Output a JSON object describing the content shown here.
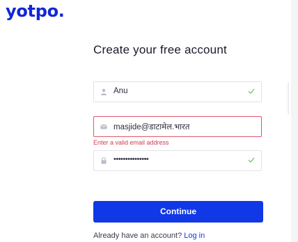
{
  "logo": {
    "text": "yotpo."
  },
  "form": {
    "title": "Create your free account",
    "name_field": {
      "value": "Anu",
      "valid": true
    },
    "email_field": {
      "value": "masjide@डाटामेल.भारत",
      "error": "Enter a valid email address"
    },
    "password_field": {
      "value": "•••••••••••••••",
      "valid": true
    },
    "continue_label": "Continue",
    "footer": {
      "prompt": "Already have an account?",
      "login_link": "Log in"
    }
  },
  "colors": {
    "brand_blue": "#1138e6",
    "error_red": "#d33b4e",
    "valid_green": "#5cc45c",
    "icon_gray": "#b8bcc8"
  },
  "icons": {
    "name": "user-icon",
    "email": "envelope-icon",
    "password": "lock-icon",
    "valid": "checkmark-icon"
  }
}
